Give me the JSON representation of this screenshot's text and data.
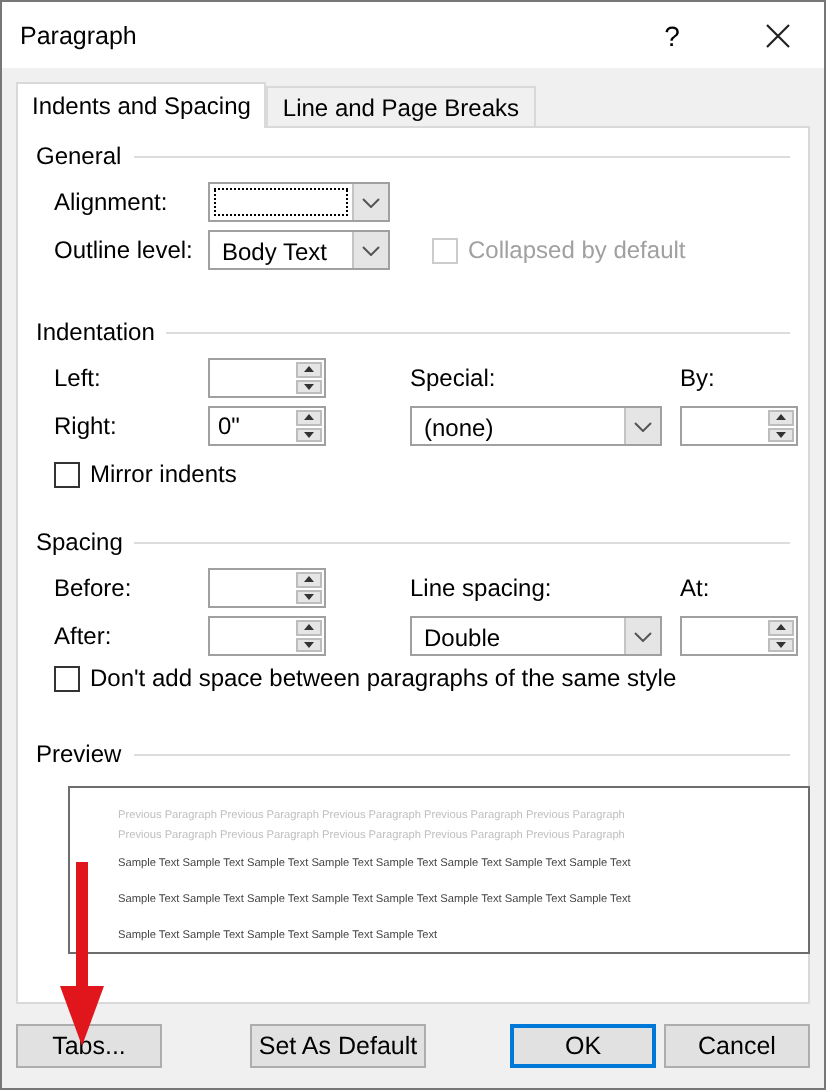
{
  "window": {
    "title": "Paragraph",
    "help": "?"
  },
  "tabs": [
    {
      "label": "Indents and Spacing",
      "selected": true
    },
    {
      "label": "Line and Page Breaks",
      "selected": false
    }
  ],
  "general": {
    "title": "General",
    "alignment": {
      "label": "Alignment:",
      "focused": true
    },
    "outline_level": {
      "label": "Outline level:",
      "value": "Body Text",
      "focused": false
    },
    "collapsed": {
      "label": "Collapsed by default",
      "checked": false,
      "disabled": true
    }
  },
  "indentation": {
    "title": "Indentation",
    "left": {
      "label": "Left:"
    },
    "right": {
      "label": "Right:",
      "value": "0\""
    },
    "special": {
      "label": "Special:",
      "value": "(none)"
    },
    "by": {
      "label": "By:"
    },
    "mirror": {
      "label": "Mirror indents",
      "checked": false,
      "disabled": false
    }
  },
  "spacing": {
    "title": "Spacing",
    "before": {
      "label": "Before:"
    },
    "after": {
      "label": "After:"
    },
    "line_spacing": {
      "label": "Line spacing:",
      "value": "Double"
    },
    "at": {
      "label": "At:"
    },
    "dont_add": {
      "label": "Don't add space between paragraphs of the same style",
      "checked": false,
      "disabled": false
    }
  },
  "preview": {
    "title": "Preview",
    "previous": [
      "Previous Paragraph Previous Paragraph Previous Paragraph Previous Paragraph Previous Paragraph",
      "Previous Paragraph Previous Paragraph Previous Paragraph Previous Paragraph Previous Paragraph"
    ],
    "sample": [
      "Sample Text Sample Text Sample Text Sample Text Sample Text Sample Text Sample Text Sample Text",
      "Sample Text Sample Text Sample Text Sample Text Sample Text Sample Text Sample Text Sample Text",
      "Sample Text Sample Text Sample Text Sample Text Sample Text"
    ]
  },
  "buttons": [
    {
      "label": "Tabs...",
      "default": false
    },
    {
      "label": "Set As Default",
      "default": false
    },
    {
      "label": "OK",
      "default": true
    },
    {
      "label": "Cancel",
      "default": false
    }
  ]
}
